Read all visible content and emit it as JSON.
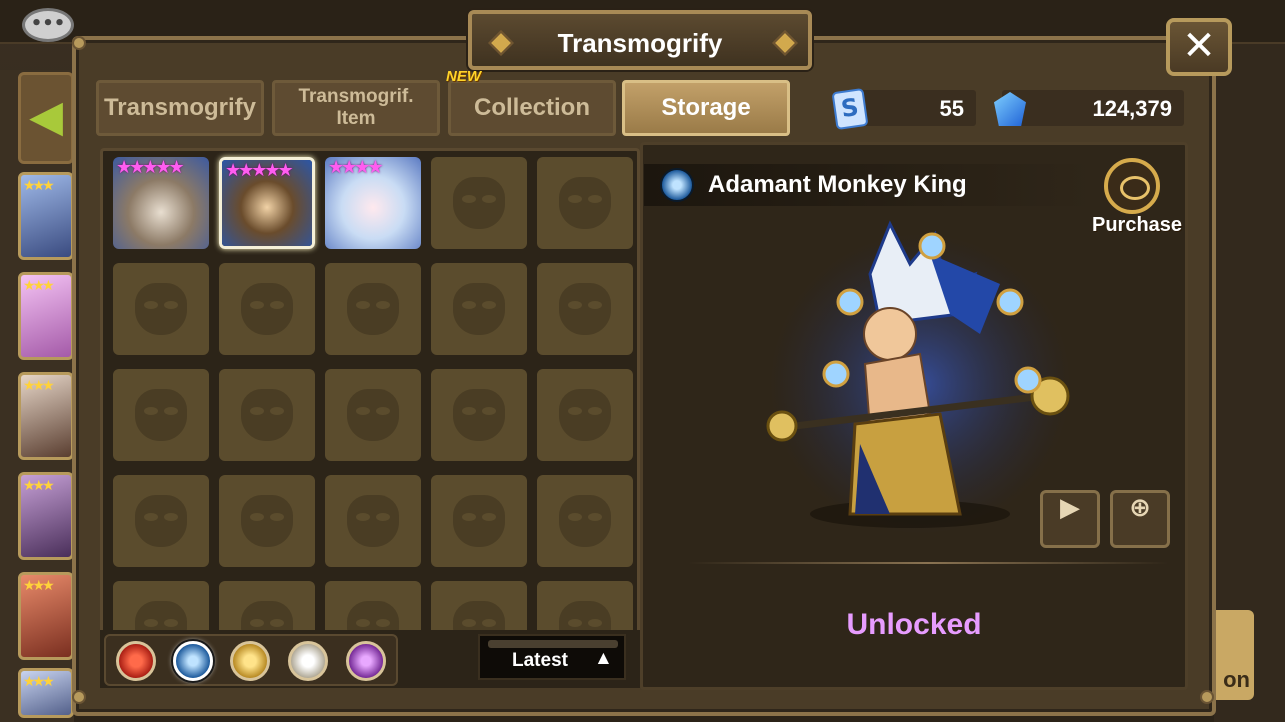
{
  "title": "Transmogrify",
  "tabs": [
    {
      "label": "Transmogrify",
      "active": false
    },
    {
      "label": "Transmogrif.",
      "label2": "Item",
      "active": false
    },
    {
      "label": "Collection",
      "badge": "NEW",
      "active": false
    },
    {
      "label": "Storage",
      "active": true
    }
  ],
  "currency": {
    "scroll": {
      "icon": "mystical-scroll-icon",
      "value": "55"
    },
    "crystal": {
      "icon": "crystal-icon",
      "value": "124,379"
    }
  },
  "grid": {
    "owned": [
      {
        "name": "skin-1",
        "stars": 5
      },
      {
        "name": "skin-2",
        "stars": 5,
        "selected": true
      },
      {
        "name": "skin-3",
        "stars": 4
      }
    ]
  },
  "elements": [
    "fire-icon",
    "water-icon",
    "wind-icon",
    "light-icon",
    "dark-icon"
  ],
  "selected_element": "water-icon",
  "sort": {
    "label": "Latest",
    "arrow": "▲"
  },
  "detail": {
    "name": "Adamant Monkey King",
    "purchase_label": "Purchase",
    "status": "Unlocked"
  },
  "background": {
    "right_button_text": "on"
  },
  "colors": {
    "accent_gold": "#b79a5c",
    "status_unlocked": "#e79cff",
    "star_pink": "#ff5df0"
  }
}
